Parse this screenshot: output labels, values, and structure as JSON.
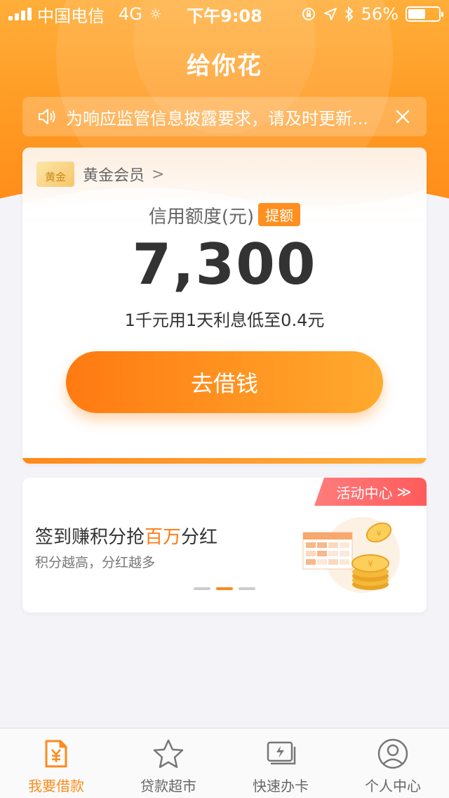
{
  "status_bar": {
    "carrier": "中国电信",
    "network": "4G",
    "time": "下午9:08",
    "battery": "56%",
    "battery_level": 0.56
  },
  "header": {
    "title": "给你花"
  },
  "notice": {
    "text": "为响应监管信息披露要求，请及时更新..."
  },
  "credit_card": {
    "member_badge": "黄金",
    "member_level": "黄金会员",
    "member_arrow": ">",
    "limit_label": "信用额度(元)",
    "increase_label": "提额",
    "limit_value": "7,300",
    "interest_text": "1千元用1天利息低至0.4元",
    "borrow_button": "去借钱"
  },
  "activity": {
    "tag": "活动中心",
    "tag_chevron": "≫",
    "title_prefix": "签到赚积分抢",
    "title_highlight": "百万",
    "title_suffix": "分红",
    "subtitle": "积分越高，分红越多",
    "carousel_active_index": 1,
    "carousel_count": 3
  },
  "tabbar": {
    "items": [
      {
        "label": "我要借款",
        "icon": "loan-document-icon",
        "active": true
      },
      {
        "label": "贷款超市",
        "icon": "star-icon",
        "active": false
      },
      {
        "label": "快速办卡",
        "icon": "card-icon",
        "active": false
      },
      {
        "label": "个人中心",
        "icon": "person-icon",
        "active": false
      }
    ]
  },
  "colors": {
    "primary": "#ff8a1a",
    "activity_tag": "#ff5b5b",
    "highlight": "#ff7a12"
  }
}
